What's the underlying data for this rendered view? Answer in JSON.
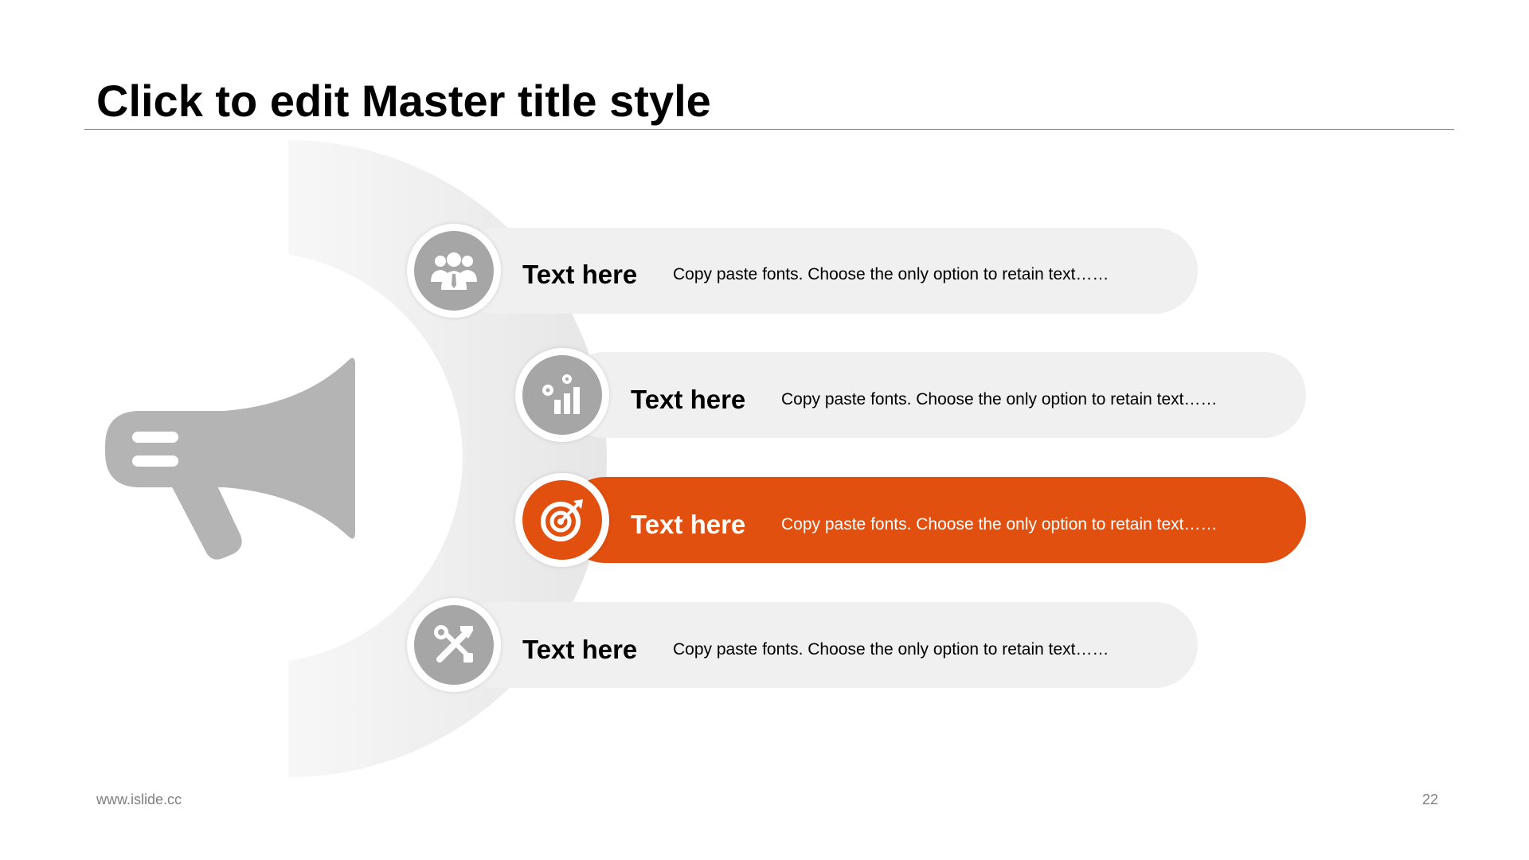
{
  "slide": {
    "title": "Click to edit Master title style",
    "footer_url": "www.islide.cc",
    "page_number": "22"
  },
  "rows": [
    {
      "title": "Text here",
      "description": "Copy paste fonts. Choose the only option to retain text……",
      "icon": "team-icon",
      "highlighted": false
    },
    {
      "title": "Text here",
      "description": "Copy paste fonts. Choose the only option to retain text……",
      "icon": "chart-gears-icon",
      "highlighted": false
    },
    {
      "title": "Text here",
      "description": "Copy paste fonts. Choose the only option to retain text……",
      "icon": "target-icon",
      "highlighted": true
    },
    {
      "title": "Text here",
      "description": "Copy paste fonts. Choose the only option to retain text……",
      "icon": "tools-icon",
      "highlighted": false
    }
  ],
  "colors": {
    "accent": "#e2500f",
    "pill": "#f0f0f0",
    "icon_gray": "#a6a6a6",
    "megaphone": "#b4b4b4"
  }
}
